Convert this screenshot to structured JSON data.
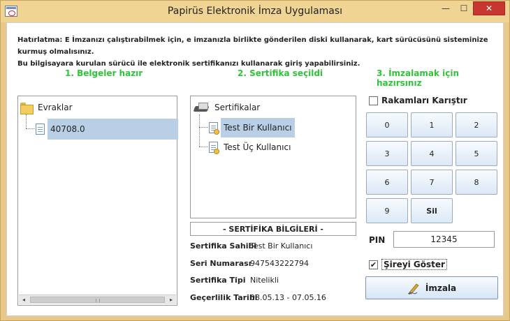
{
  "window": {
    "title": "Papirüs Elektronik İmza Uygulaması",
    "minimize": "—",
    "maximize": "☐",
    "close": "✕"
  },
  "reminder": {
    "line1": "Hatırlatma: E İmzanızı çalıştırabilmek için, e imzanızla birlikte gönderilen diski kullanarak, kart sürücüsünü sisteminize kurmuş olmalısınız.",
    "line2": "Bu bilgisayara kurulan sürücü ile elektronik sertifikanızı kullanarak giriş yapabilirsiniz."
  },
  "steps": {
    "documents": "1. Belgeler hazır",
    "certificate": "2. Sertifika seçildi",
    "ready": "3. İmzalamak için hazırsınız"
  },
  "documents_tree": {
    "root": "Evraklar",
    "items": [
      "40708.0"
    ],
    "scroll_left": "◂",
    "scroll_right": "▸"
  },
  "certificate_tree": {
    "root": "Sertifikalar",
    "items": [
      "Test Bir Kullanıcı",
      "Test Üç Kullanıcı"
    ]
  },
  "certificate_info": {
    "header": "- SERTİFİKA BİLGİLERİ -",
    "owner_label": "Sertifika Sahibi",
    "owner_value": "Test Bir Kullanıcı",
    "serial_label": "Seri Numarası",
    "serial_value": "947543222794",
    "type_label": "Sertifika Tipi",
    "type_value": "Nitelikli",
    "validity_label": "Geçerlilik Tarihi",
    "validity_value": "08.05.13 - 07.05.16"
  },
  "signing": {
    "shuffle_label": "Rakamları Karıştır",
    "shuffle_checked": false,
    "keypad": [
      "0",
      "1",
      "2",
      "3",
      "4",
      "5",
      "6",
      "7",
      "8",
      "9",
      "Sil"
    ],
    "pin_label": "PIN",
    "pin_value": "12345",
    "show_pin_label": "Şireyi Göster",
    "show_pin_check": "✔",
    "show_pin_checked": true,
    "sign_button": "İmzala"
  },
  "colors": {
    "step_green": "#2fc33a",
    "selection": "#b9cfe6",
    "close_red": "#c7372f"
  }
}
